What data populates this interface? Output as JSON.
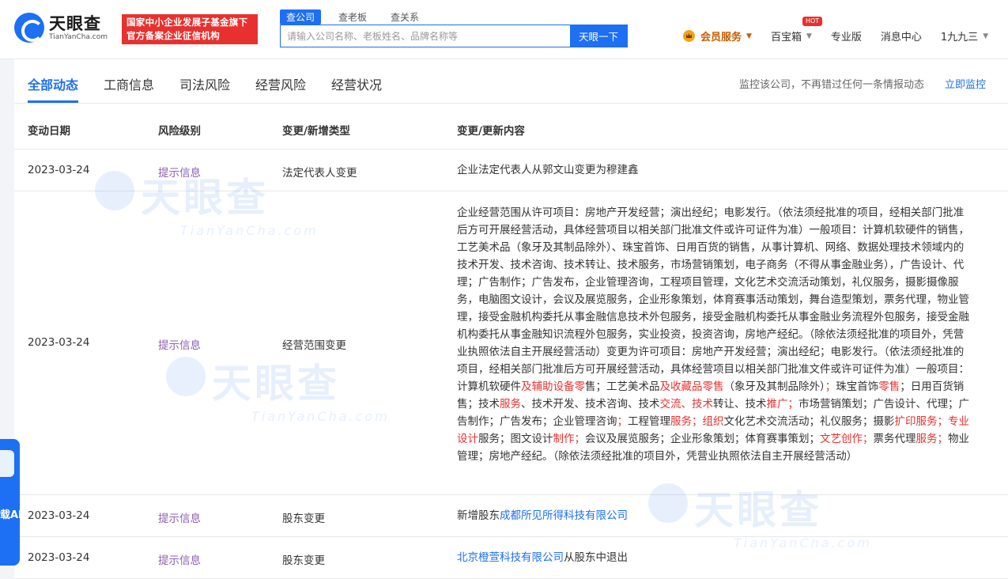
{
  "brand": {
    "name": "天眼查",
    "domain": "TianYanCha.com",
    "badge_line1": "国家中小企业发展子基金旗下",
    "badge_line2": "官方备案企业征信机构",
    "primary_color": "#1d6ff3"
  },
  "search": {
    "tabs": [
      "查公司",
      "查老板",
      "查关系"
    ],
    "active_tab": "查公司",
    "placeholder": "请输入公司名称、老板姓名、品牌名称等",
    "button_label": "天眼一下"
  },
  "nav": {
    "vip_label": "会员服务",
    "treasure_label": "百宝箱",
    "hot_badge": "HOT",
    "pro_label": "专业版",
    "messages_label": "消息中心",
    "user_label": "1九九三"
  },
  "tabs": [
    "全部动态",
    "工商信息",
    "司法风险",
    "经营风险",
    "经营状况"
  ],
  "active_tab": "全部动态",
  "monitor": {
    "text": "监控该公司，不再错过任何一条情报动态",
    "link": "立即监控"
  },
  "table": {
    "headers": [
      "变动日期",
      "风险级别",
      "变更/新增类型",
      "变更/更新内容"
    ],
    "rows": [
      {
        "date": "2023-03-24",
        "level": "提示信息",
        "type": "法定代表人变更",
        "content": "企业法定代表人从郭文山变更为穆建鑫"
      },
      {
        "date": "2023-03-24",
        "level": "提示信息",
        "type": "经营范围变更",
        "content_before": "企业经营范围从许可项目：房地产开发经营；演出经纪；电影发行。（依法须经批准的项目，经相关部门批准后方可开展经营活动，具体经营项目以相关部门批准文件或许可证件为准）一般项目：计算机软硬件的销售，工艺美术品（象牙及其制品除外）、珠宝首饰、日用百货的销售，从事计算机、网络、数据处理技术领域内的技术开发、技术咨询、技术转让、技术服务，市场营销策划，电子商务（不得从事金融业务），广告设计、代理；广告制作；广告发布，企业管理咨询，工程项目管理，文化艺术交流活动策划，礼仪服务，摄影摄像服务，电脑图文设计，会议及展览服务，企业形象策划，体育赛事活动策划，舞台造型策划，票务代理，物业管理，接受金融机构委托从事金融信息技术外包服务，接受金融机构委托从事金融业务流程外包服务，接受金融机构委托从事金融知识流程外包服务，实业投资，投资咨询，房地产经纪。（除依法须经批准的项目外，凭营业执照依法自主开展经营活动）变更为许可项目：房地产开发经营；演出经纪；电影发行。（依法须经批准的项目，经相关部门批准后方可开展经营活动，具体经营项目以相关部门批准文件或许可证件为准）一般项目：计算机软硬件",
        "content_after": [
          {
            "t": "及辅助设备零",
            "hl": true
          },
          {
            "t": "售；工艺美术品",
            "hl": false
          },
          {
            "t": "及收藏品零售",
            "hl": true
          },
          {
            "t": "（象牙及其制品除外）",
            "hl": false
          },
          {
            "t": "；",
            "hl": true
          },
          {
            "t": "珠宝首饰",
            "hl": false
          },
          {
            "t": "零售",
            "hl": true
          },
          {
            "t": "；日用百货销售；技术",
            "hl": false
          },
          {
            "t": "服务",
            "hl": true
          },
          {
            "t": "、技术开发、技术咨询、技术",
            "hl": false
          },
          {
            "t": "交流、技术",
            "hl": true
          },
          {
            "t": "转让、技术",
            "hl": false
          },
          {
            "t": "推广；",
            "hl": true
          },
          {
            "t": "市场营销策划；广告设计、代理；广告制作；广告发布；企业管理咨询",
            "hl": false
          },
          {
            "t": "；",
            "hl": true
          },
          {
            "t": "工程管理",
            "hl": false
          },
          {
            "t": "服务；组织",
            "hl": true
          },
          {
            "t": "文化艺术交流活动；礼仪服务；摄影",
            "hl": false
          },
          {
            "t": "扩印服务；专业设计",
            "hl": true
          },
          {
            "t": "服务；图文设计",
            "hl": false
          },
          {
            "t": "制作；",
            "hl": true
          },
          {
            "t": "会议及展览服务；企业形象策划；体育赛事策划；",
            "hl": false
          },
          {
            "t": "文艺创作；",
            "hl": true
          },
          {
            "t": "票务代理",
            "hl": false
          },
          {
            "t": "服务；",
            "hl": true
          },
          {
            "t": "物业管理；房地产经纪。（除依法须经批准的项目外，凭营业执照依法自主开展经营活动）",
            "hl": false
          }
        ]
      },
      {
        "date": "2023-03-24",
        "level": "提示信息",
        "type": "股东变更",
        "content_prefix": "新增股东",
        "content_link": "成都所见所得科技有限公司",
        "content_suffix": ""
      },
      {
        "date": "2023-03-24",
        "level": "提示信息",
        "type": "股东变更",
        "content_prefix": "",
        "content_link": "北京橙萱科技有限公司",
        "content_suffix": "从股东中退出"
      }
    ]
  },
  "watermark": {
    "cn": "天眼查",
    "en": "TianYanCha.com"
  },
  "float_widget": {
    "label": "载APP"
  },
  "colors": {
    "highlight_red": "#e8312f",
    "level_purple": "#8b5fb0",
    "link_blue": "#1d6ff3"
  }
}
